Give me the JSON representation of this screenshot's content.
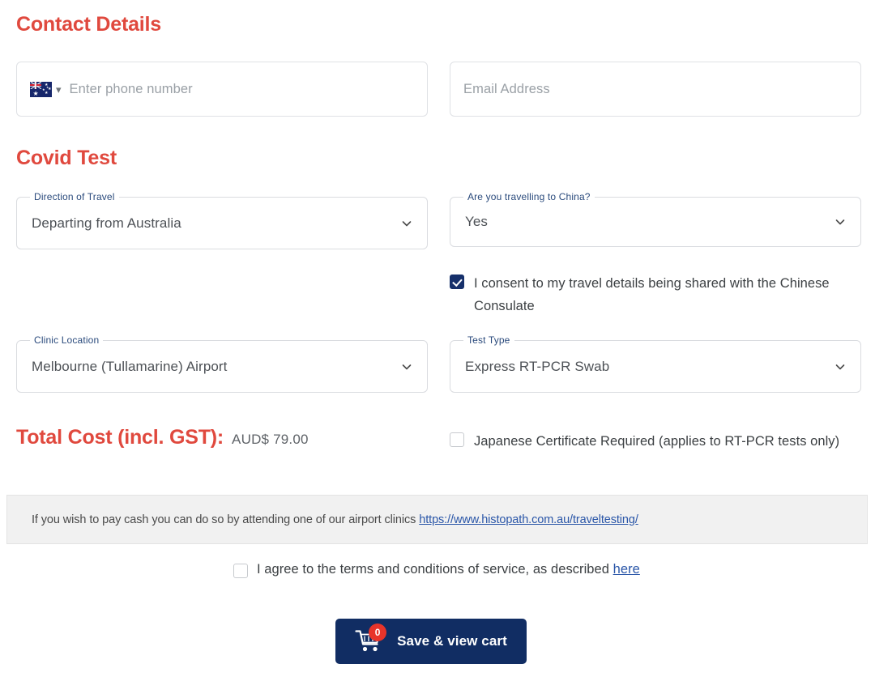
{
  "sections": {
    "contact": {
      "heading": "Contact Details"
    },
    "covid": {
      "heading": "Covid Test"
    }
  },
  "contact": {
    "phone": {
      "country_flag": "australia-flag",
      "placeholder": "Enter phone number",
      "value": ""
    },
    "email": {
      "placeholder": "Email Address",
      "value": ""
    }
  },
  "covid": {
    "direction": {
      "legend": "Direction of Travel",
      "value": "Departing from Australia"
    },
    "china": {
      "legend": "Are you travelling to China?",
      "value": "Yes"
    },
    "consent": {
      "label": "I consent to my travel details being shared with the Chinese Consulate",
      "checked": true
    },
    "clinic": {
      "legend": "Clinic Location",
      "value": "Melbourne (Tullamarine) Airport"
    },
    "test_type": {
      "legend": "Test Type",
      "value": "Express RT-PCR Swab"
    }
  },
  "total": {
    "label": "Total Cost (incl. GST):",
    "value": "AUD$ 79.00"
  },
  "japanese_certificate": {
    "label": "Japanese Certificate Required (applies to RT-PCR tests only)",
    "checked": false
  },
  "cash_notice": {
    "text": "If you wish to pay cash you can do so by attending one of our airport clinics",
    "link_text": "https://www.histopath.com.au/traveltesting/"
  },
  "terms": {
    "text": "I agree to the terms and conditions of service, as described",
    "link_text": "here",
    "checked": false
  },
  "save_cart": {
    "label": "Save & view cart",
    "badge_count": "0",
    "icon": "shopping-cart-icon"
  },
  "colors": {
    "heading_red": "#e0493e",
    "legend_blue": "#2a4a7c",
    "button_navy": "#112d63",
    "badge_red": "#e8342a",
    "link_blue": "#2a56a8",
    "checkbox_navy": "#16306b"
  }
}
